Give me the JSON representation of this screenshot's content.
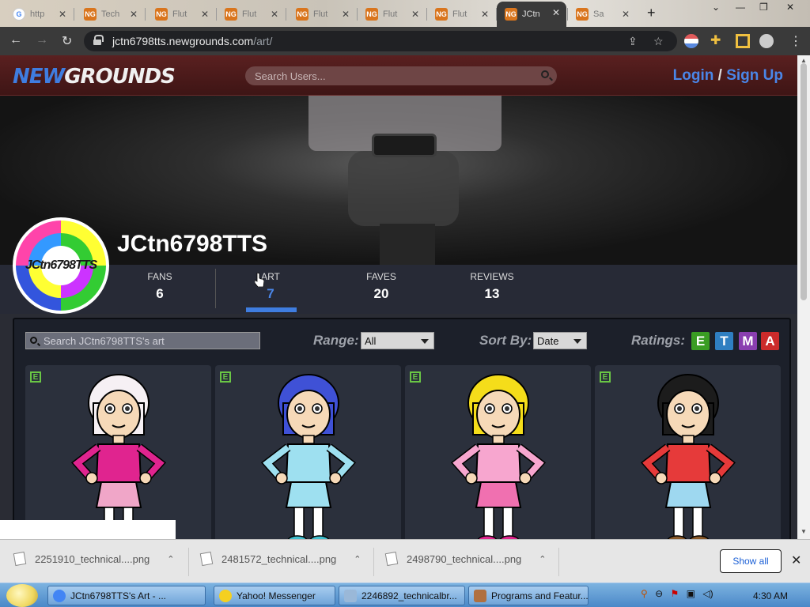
{
  "browser": {
    "tabs": [
      {
        "title": "http",
        "icon": "google"
      },
      {
        "title": "Tech",
        "icon": "ng"
      },
      {
        "title": "Flut",
        "icon": "ng"
      },
      {
        "title": "Flut",
        "icon": "ng"
      },
      {
        "title": "Flut",
        "icon": "ng"
      },
      {
        "title": "Flut",
        "icon": "ng"
      },
      {
        "title": "Flut",
        "icon": "ng"
      },
      {
        "title": "JCtn",
        "icon": "ng",
        "active": true
      },
      {
        "title": "Sa",
        "icon": "ng"
      }
    ],
    "new_tab": "+",
    "url_host": "jctn6798tts.newgrounds.com",
    "url_path": "/art/"
  },
  "site": {
    "logo_new": "NEW",
    "logo_grounds": "GROUNDS",
    "search_placeholder": "Search Users...",
    "login": "Login",
    "slash": "/",
    "signup": "Sign Up"
  },
  "profile": {
    "name": "JCtn6798TTS",
    "avatar_text": "JCtn6798TTS",
    "stats": [
      {
        "label": "FANS",
        "value": "6"
      },
      {
        "label": "ART",
        "value": "7",
        "active": true
      },
      {
        "label": "FAVES",
        "value": "20"
      },
      {
        "label": "REVIEWS",
        "value": "13"
      }
    ]
  },
  "art_controls": {
    "search_placeholder": "Search JCtn6798TTS's art",
    "range_label": "Range:",
    "range_value": "All",
    "sort_label": "Sort By:",
    "sort_value": "Date",
    "ratings_label": "Ratings:",
    "ratings": [
      {
        "letter": "E",
        "color": "#3a9d23"
      },
      {
        "letter": "T",
        "color": "#2f7fc1"
      },
      {
        "letter": "M",
        "color": "#8a3fb0"
      },
      {
        "letter": "A",
        "color": "#cc2b2b"
      }
    ]
  },
  "artworks": [
    {
      "rating": "E",
      "hair": "#f6f0f4",
      "top": "#e0248f",
      "skirt": "#f0a6c8",
      "shoes": "#e0248f"
    },
    {
      "rating": "E",
      "hair": "#3f51d6",
      "top": "#9ee0f0",
      "skirt": "#9ee0f0",
      "shoes": "#40c0d0"
    },
    {
      "rating": "E",
      "hair": "#f5dd1a",
      "top": "#f7a6cf",
      "skirt": "#f070b0",
      "shoes": "#e0248f"
    },
    {
      "rating": "E",
      "hair": "#1c1c1c",
      "top": "#e63a3a",
      "skirt": "#9ed8f0",
      "shoes": "#8a5a2a"
    }
  ],
  "downloads": [
    {
      "name": "2251910_technical....png"
    },
    {
      "name": "2481572_technical....png"
    },
    {
      "name": "2498790_technical....png"
    }
  ],
  "downloads_show_all": "Show all",
  "taskbar": {
    "items": [
      {
        "label": "JCtn6798TTS's Art - ..."
      },
      {
        "label": "Yahoo! Messenger"
      },
      {
        "label": "2246892_technicalbr..."
      },
      {
        "label": "Programs and Featur..."
      }
    ],
    "clock": "4:30 AM"
  },
  "colors": {
    "accent": "#4a86e8",
    "header": "#4a1a1a",
    "page_bg": "#2a2c34"
  }
}
